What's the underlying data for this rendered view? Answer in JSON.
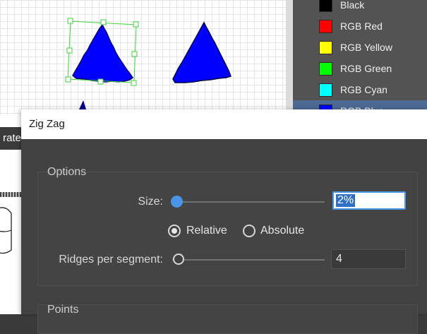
{
  "swatches": [
    {
      "label": "Black",
      "color": "#000000"
    },
    {
      "label": "RGB Red",
      "color": "#ff0000"
    },
    {
      "label": "RGB Yellow",
      "color": "#ffff00"
    },
    {
      "label": "RGB Green",
      "color": "#00ff00"
    },
    {
      "label": "RGB Cyan",
      "color": "#00ffff"
    },
    {
      "label": "RGB Blue",
      "color": "#0000ff",
      "selected": true
    }
  ],
  "background_tab": {
    "label": "rate"
  },
  "canvas": {
    "shape_fill": "#0000ff",
    "selection_color": "#3ed23e"
  },
  "dialog": {
    "title": "Zig Zag",
    "options": {
      "label": "Options",
      "size": {
        "label": "Size:",
        "value": "2%"
      },
      "relative_label": "Relative",
      "absolute_label": "Absolute",
      "mode_selected": "Relative",
      "ridges": {
        "label": "Ridges per segment:",
        "value": "4"
      }
    },
    "points": {
      "label": "Points"
    }
  }
}
